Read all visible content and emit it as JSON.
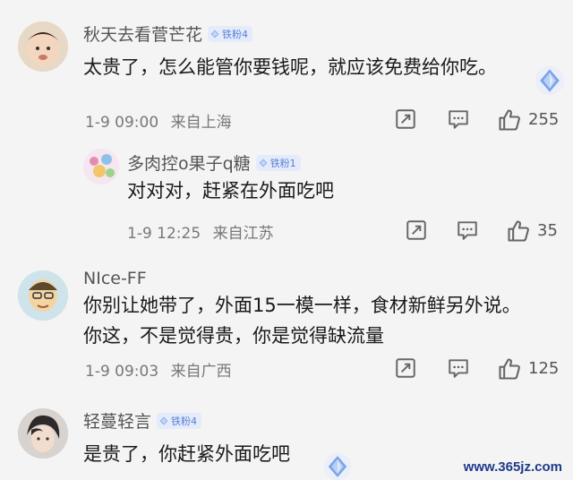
{
  "comments": [
    {
      "username": "秋天去看菅芒花",
      "badge": "铁粉4",
      "text_lines": [
        "太贵了，怎么能管你要钱呢，就应该免费给你吃。"
      ],
      "date": "1-9 09:00",
      "location": "来自上海",
      "likes": "255"
    },
    {
      "username": "多肉控o果子q糖",
      "badge": "铁粉1",
      "text_lines": [
        "对对对，赶紧在外面吃吧"
      ],
      "date": "1-9 12:25",
      "location": "来自江苏",
      "likes": "35"
    },
    {
      "username": "NIce-FF",
      "badge": "",
      "text_lines": [
        "你别让她带了，外面15一模一样，食材新鲜另外说。",
        "你这，不是觉得贵，你是觉得缺流量"
      ],
      "date": "1-9 09:03",
      "location": "来自广西",
      "likes": "125"
    },
    {
      "username": "轻蔓轻言",
      "badge": "铁粉4",
      "text_lines": [
        "是贵了，你赶紧外面吃吧"
      ]
    }
  ],
  "watermark": "www.365jz.com",
  "icons": {
    "share": "share-icon",
    "comment": "comment-icon",
    "like": "thumbs-up-icon",
    "badge": "diamond-icon",
    "sparkle": "diamond-sparkle-icon"
  },
  "colors": {
    "background": "#f4f4f4",
    "badge_bg": "#e4ecfb",
    "badge_text": "#5a7fd6",
    "meta": "#777777"
  }
}
